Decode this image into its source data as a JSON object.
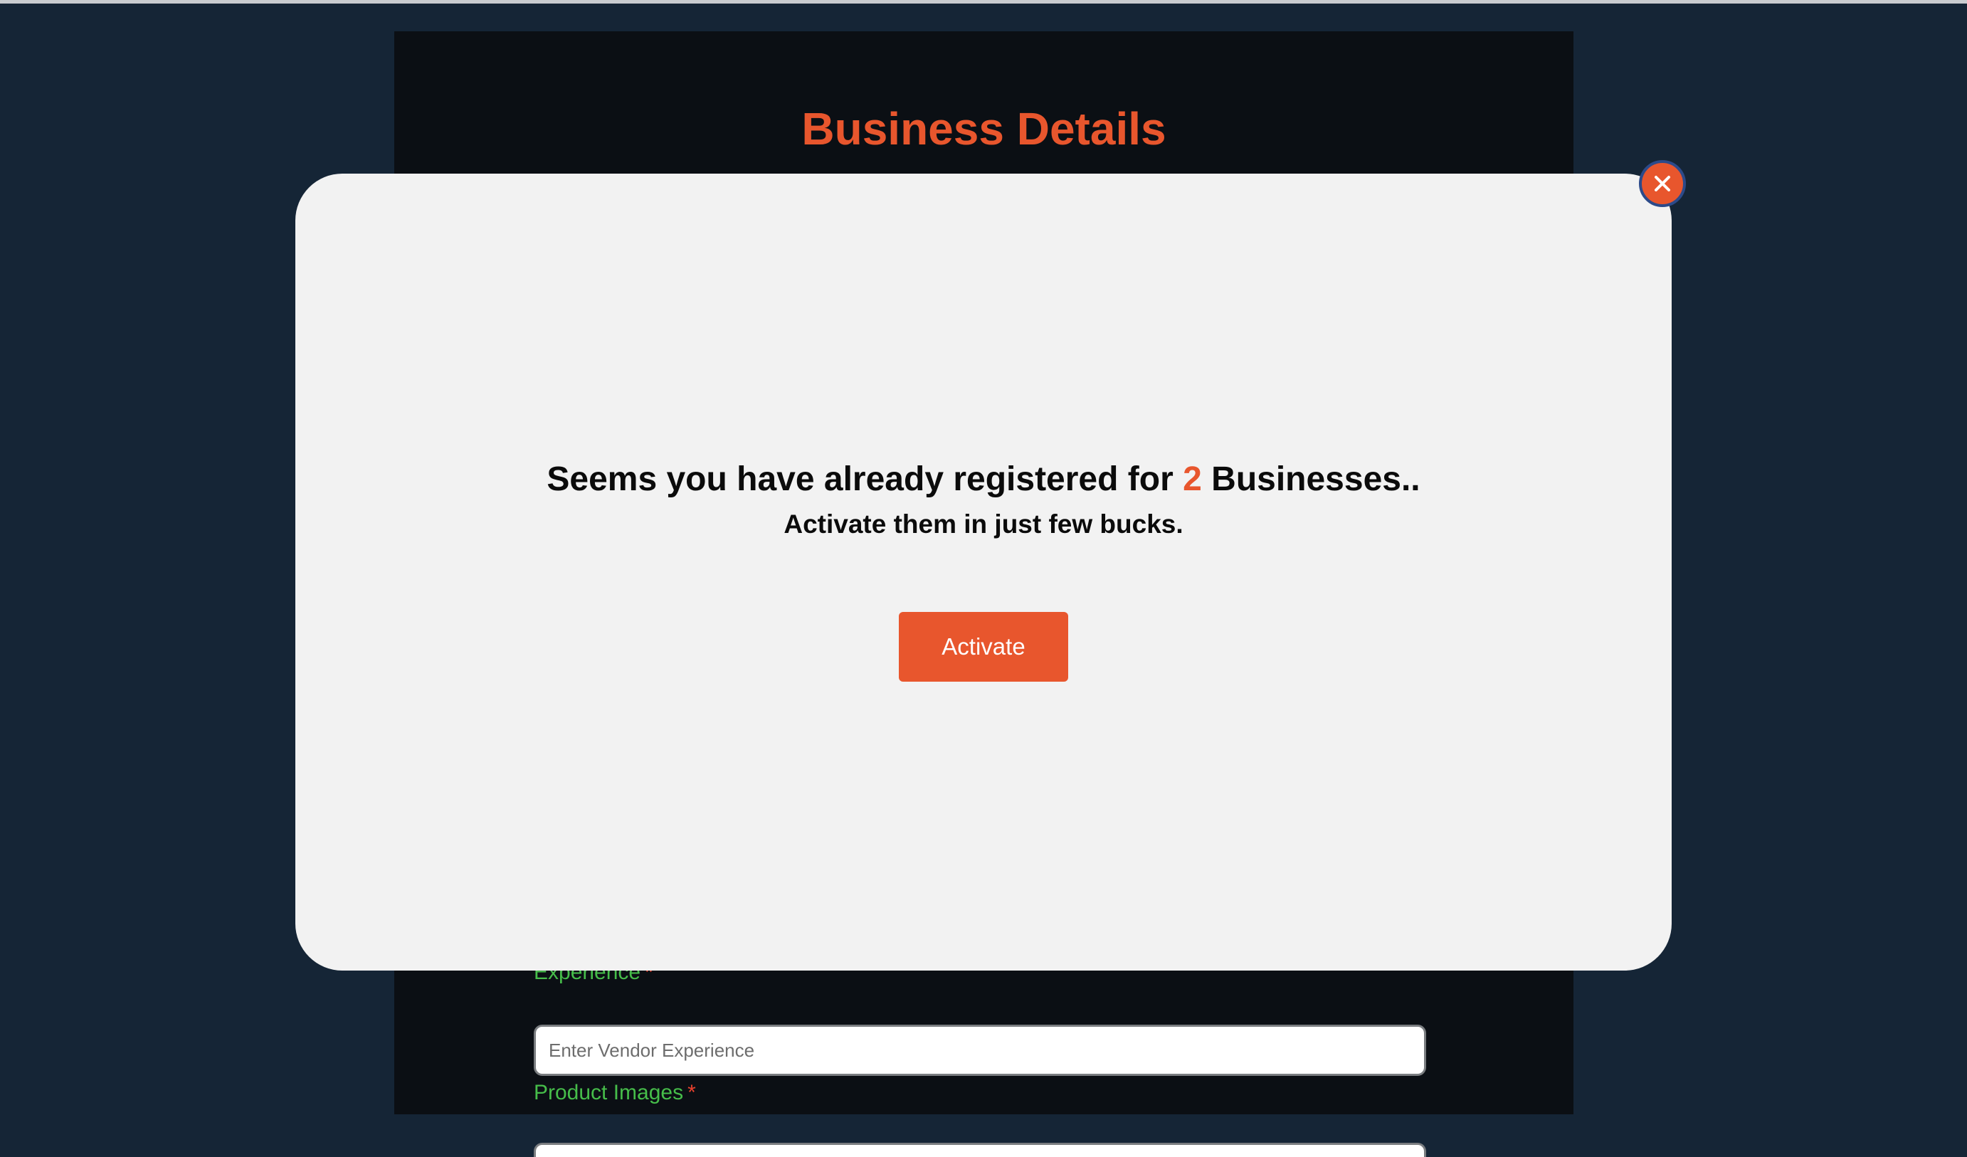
{
  "page": {
    "title": "Business Details"
  },
  "form": {
    "experience": {
      "label": "Experience",
      "required_mark": "*",
      "placeholder": "Enter Vendor Experience",
      "value": ""
    },
    "product_images": {
      "label": "Product Images",
      "required_mark": "*"
    }
  },
  "modal": {
    "heading_prefix": "Seems you have already registered for ",
    "business_count": "2",
    "heading_suffix": " Businesses..",
    "subheading": "Activate them in just few bucks.",
    "activate_label": "Activate",
    "close_icon": "close-icon"
  },
  "colors": {
    "accent": "#e8562d",
    "page_background": "#152536",
    "card_background": "#0b0f14",
    "modal_background": "#f2f2f2",
    "label_green": "#46bd4a",
    "required_red": "#e8412d"
  }
}
